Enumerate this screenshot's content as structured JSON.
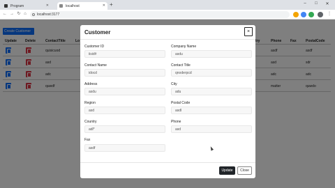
{
  "browser": {
    "tabs": [
      {
        "title": "Program"
      },
      {
        "title": "localhost"
      }
    ],
    "new_tab": "+",
    "window_controls": {
      "minimize": "–",
      "maximize": "□",
      "close": "✕"
    },
    "address": "localhost:3177"
  },
  "page": {
    "create_button": "Create Customer",
    "table": {
      "headers": [
        "Update",
        "Delete",
        "ContactTitle",
        "Lo",
        "try",
        "Phone",
        "Fax",
        "PostalCode"
      ],
      "rows": [
        {
          "col_a": "quisicuod",
          "col_b": "asdf",
          "col_c": "asdf"
        },
        {
          "col_a": "asd",
          "col_b": "asd",
          "col_c": "sdr"
        },
        {
          "col_a": "adc",
          "col_b": "adc",
          "col_c": "adc"
        },
        {
          "col_a": "quwdf",
          "col_b": "matter",
          "col_c": "quwdo"
        }
      ]
    }
  },
  "modal": {
    "title": "Customer",
    "close_icon": "×",
    "fields": {
      "customer_id": {
        "label": "Customer ID",
        "value": "iisid#"
      },
      "company_name": {
        "label": "Company Name",
        "value": "asdu"
      },
      "contact_name": {
        "label": "Contact Name",
        "value": "idocd"
      },
      "contact_title": {
        "label": "Contact Title",
        "value": "qnoderpcd"
      },
      "address": {
        "label": "Address",
        "value": "asdu"
      },
      "city": {
        "label": "City",
        "value": "adu"
      },
      "region": {
        "label": "Region",
        "value": "asd"
      },
      "postal_code": {
        "label": "Postal Code",
        "value": "asdl"
      },
      "country": {
        "label": "Country",
        "value": "adl*"
      },
      "phone": {
        "label": "Phone",
        "value": "asd"
      },
      "fax": {
        "label": "Fax",
        "value": "asdf"
      }
    },
    "update_button": "Update",
    "close_button": "Close"
  }
}
